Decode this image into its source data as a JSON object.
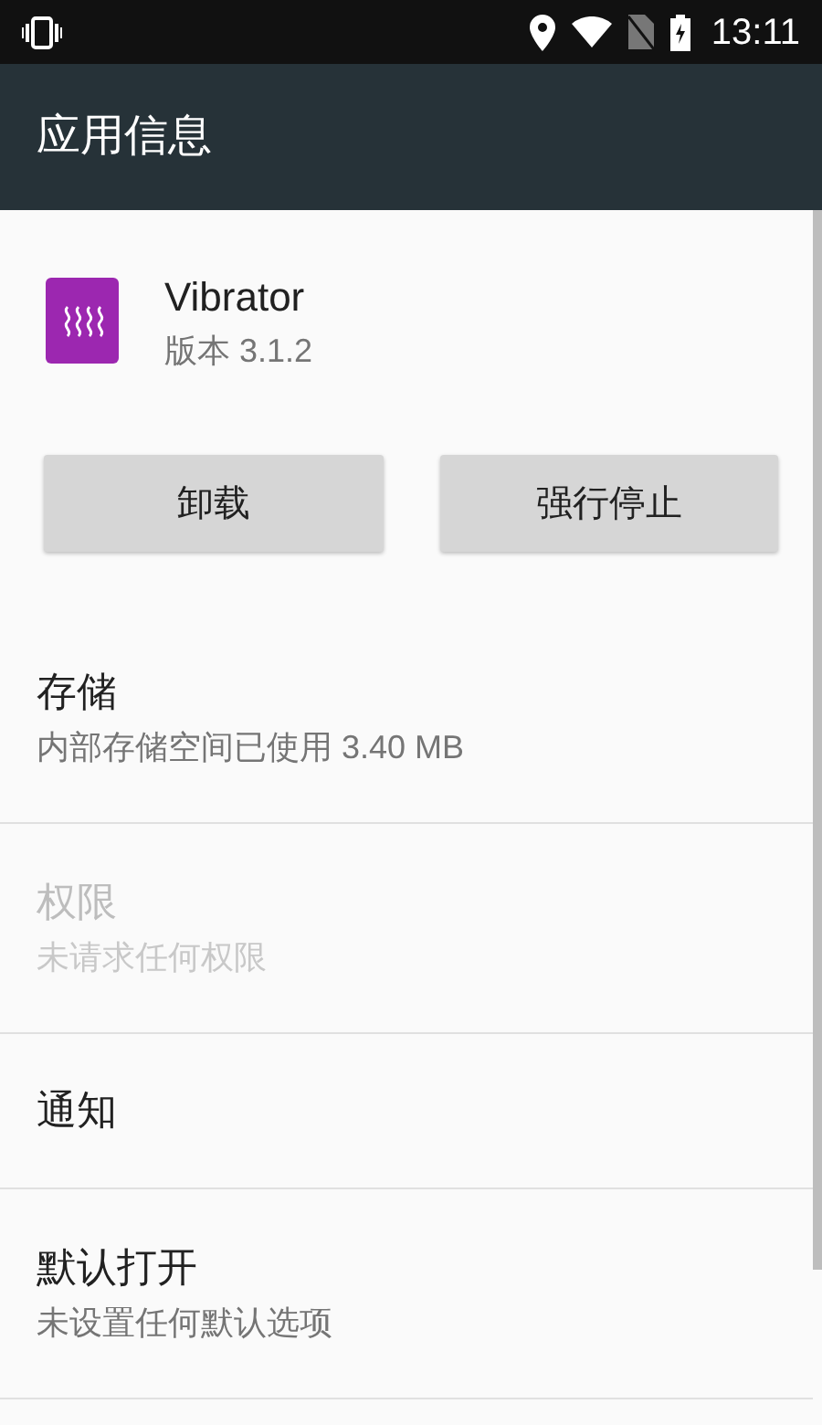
{
  "status_bar": {
    "time": "13:11"
  },
  "app_bar": {
    "title": "应用信息"
  },
  "app": {
    "name": "Vibrator",
    "version": "版本 3.1.2"
  },
  "buttons": [
    "卸载",
    "强行停止"
  ],
  "items": [
    {
      "title": "存储",
      "summary": "内部存储空间已使用 3.40 MB",
      "disabled": false
    },
    {
      "title": "权限",
      "summary": "未请求任何权限",
      "disabled": true
    },
    {
      "title": "通知",
      "disabled": false
    },
    {
      "title": "默认打开",
      "summary": "未设置任何默认选项",
      "disabled": false
    }
  ]
}
